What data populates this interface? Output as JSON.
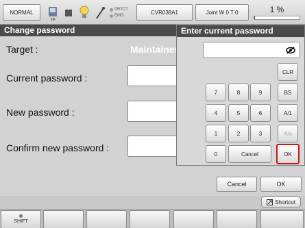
{
  "topbar": {
    "mode": "NORMAL",
    "tp_label": "TP",
    "prtct": "PRTCT",
    "emg": "EMG",
    "program": "CVR038A1",
    "joint": "Joint W 0 T 0",
    "speed_label": "1 %",
    "speed_fraction": 0.01
  },
  "panel": {
    "title": "Change password",
    "target_label": "Target :",
    "target_value": "Maintainer",
    "current_label": "Current password :",
    "new_label": "New password :",
    "confirm_label": "Confirm new password :",
    "cancel": "Cancel",
    "ok": "OK"
  },
  "keypad": {
    "title": "Enter current password",
    "input_value": "",
    "keys": {
      "k7": "7",
      "k8": "8",
      "k9": "9",
      "k4": "4",
      "k5": "5",
      "k6": "6",
      "k1": "1",
      "k2": "2",
      "k3": "3",
      "k0": "0",
      "clr": "CLR",
      "bs": "BS",
      "a1": "A/1",
      "aa": "A/a",
      "cancel": "Cancel",
      "ok": "OK"
    }
  },
  "shortcut": "Shortcut",
  "fkeys": {
    "shift": "SHIFT"
  },
  "colors": {
    "header": "#4a4a4a",
    "ok_highlight": "#d0101a"
  }
}
